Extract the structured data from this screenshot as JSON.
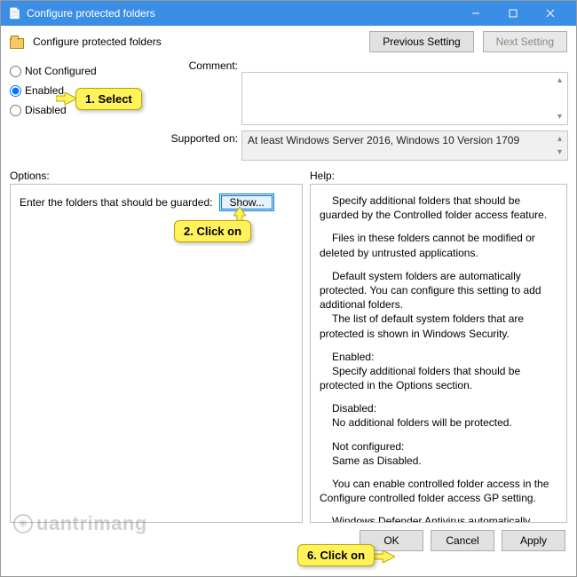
{
  "titlebar": {
    "title": "Configure protected folders"
  },
  "header": {
    "title": "Configure protected folders",
    "prev": "Previous Setting",
    "next": "Next Setting"
  },
  "state": {
    "not_configured": "Not Configured",
    "enabled": "Enabled",
    "disabled": "Disabled",
    "selected": "enabled"
  },
  "comment": {
    "label": "Comment:",
    "value": ""
  },
  "supported": {
    "label": "Supported on:",
    "value": "At least Windows Server 2016, Windows 10 Version 1709"
  },
  "panes": {
    "options_label": "Options:",
    "help_label": "Help:",
    "options_row": "Enter the folders that should be guarded:",
    "show_btn": "Show..."
  },
  "help": {
    "p1": "Specify additional folders that should be guarded by the Controlled folder access feature.",
    "p2": "Files in these folders cannot be modified or deleted by untrusted applications.",
    "p3": "Default system folders are automatically protected. You can configure this setting to add additional folders.",
    "p3b": "The list of default system folders that are protected is shown in Windows Security.",
    "p4a": "Enabled:",
    "p4b": "Specify additional folders that should be protected in the Options section.",
    "p5a": "Disabled:",
    "p5b": "No additional folders will be protected.",
    "p6a": "Not configured:",
    "p6b": "Same as Disabled.",
    "p7": "You can enable controlled folder access in the Configure controlled folder access GP setting.",
    "p8": "Windows Defender Antivirus automatically determines which applications can be trusted. You can add additional trusted applications in the Configure allowed applications GP setting."
  },
  "footer": {
    "ok": "OK",
    "cancel": "Cancel",
    "apply": "Apply"
  },
  "callouts": {
    "c1": "1. Select",
    "c2": "2. Click on",
    "c6": "6. Click on"
  }
}
